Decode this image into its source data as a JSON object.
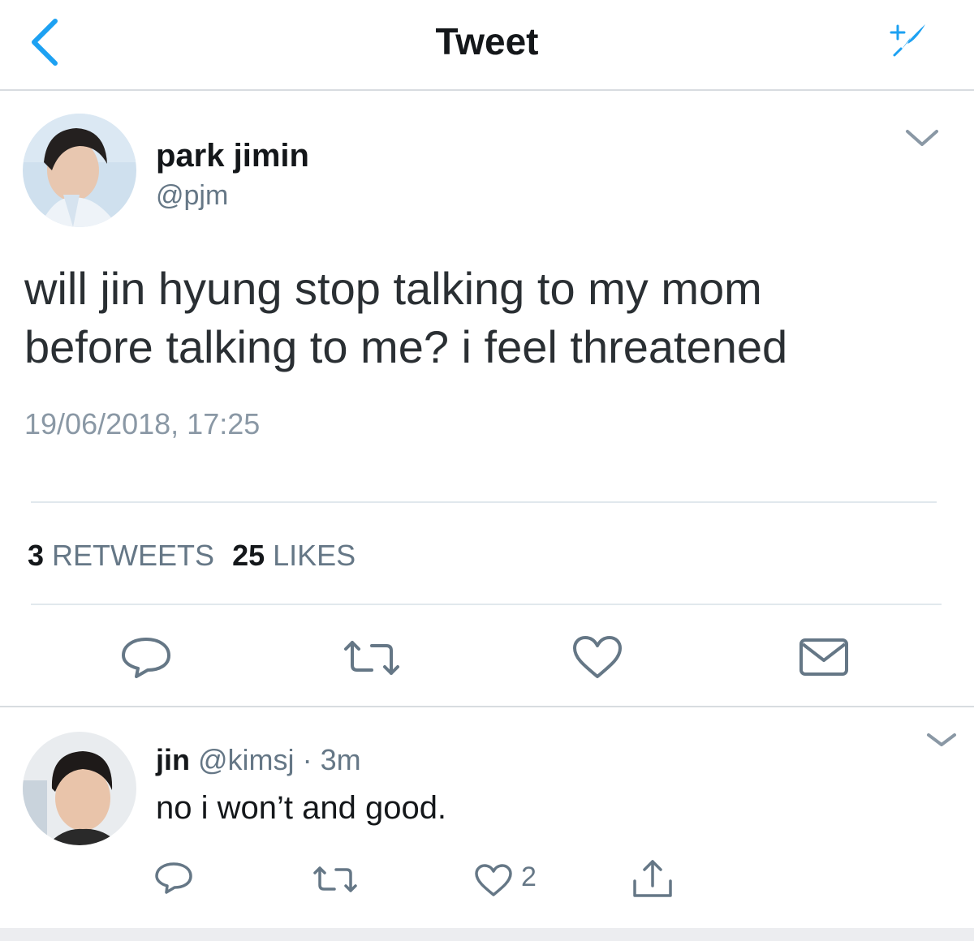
{
  "header": {
    "title": "Tweet"
  },
  "tweet": {
    "display_name": "park jimin",
    "handle": "@pjm",
    "text_line1": "will jin hyung stop talking to my mom",
    "text_line2": "before talking to me? i feel threatened",
    "timestamp": "19/06/2018, 17:25",
    "retweets_count": "3",
    "retweets_label": "RETWEETS",
    "likes_count": "25",
    "likes_label": "LIKES"
  },
  "reply": {
    "display_name": "jin",
    "handle": "@kimsj",
    "separator": "·",
    "time": "3m",
    "text": "no i won’t and good.",
    "like_count": "2"
  },
  "colors": {
    "accent": "#1da1f2",
    "icon_gray": "#657786",
    "text_dark": "#14171a",
    "divider": "#e1e8ed"
  },
  "icons": [
    "back-chevron-icon",
    "compose-feather-icon",
    "chevron-down-icon",
    "reply-icon",
    "retweet-icon",
    "like-icon",
    "message-icon",
    "share-icon"
  ]
}
